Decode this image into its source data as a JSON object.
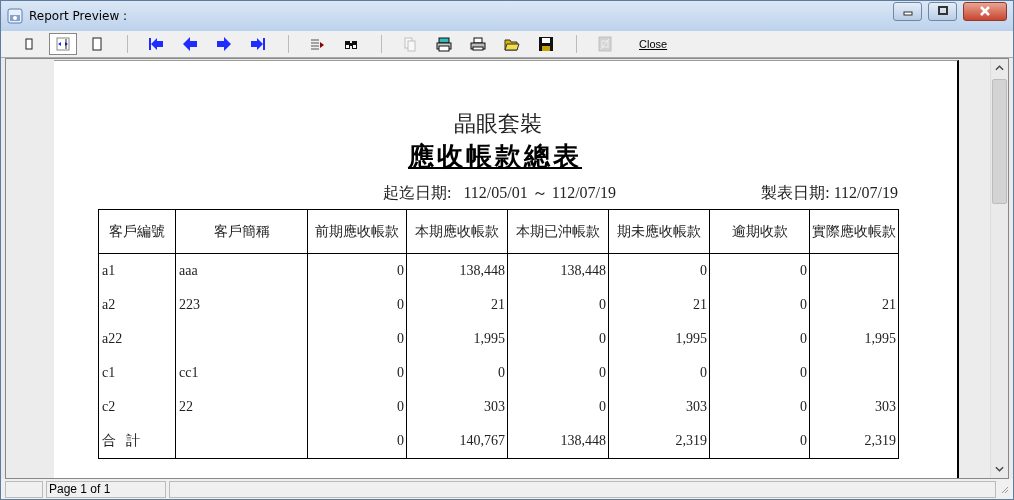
{
  "window": {
    "title": "Report Preview :"
  },
  "toolbar": [
    [
      {
        "kind": "page-small",
        "selected": false
      },
      {
        "kind": "page-width",
        "selected": true
      },
      {
        "kind": "page-full",
        "selected": false
      }
    ],
    [
      {
        "kind": "first"
      },
      {
        "kind": "prev"
      },
      {
        "kind": "next"
      },
      {
        "kind": "last"
      }
    ],
    [
      {
        "kind": "goto"
      },
      {
        "kind": "find"
      }
    ],
    [
      {
        "kind": "pages",
        "disabled": true
      },
      {
        "kind": "print-setup"
      },
      {
        "kind": "print"
      },
      {
        "kind": "open"
      },
      {
        "kind": "save"
      }
    ],
    [
      {
        "kind": "export",
        "disabled": true
      },
      {
        "kind": "text",
        "label": "Close"
      }
    ]
  ],
  "report": {
    "company": "晶眼套裝",
    "title": "應收帳款總表",
    "period_label": "起迄日期:",
    "period": "112/05/01 ～ 112/07/19",
    "print_date": "製表日期: 112/07/19",
    "table": {
      "columns": [
        "客戶編號",
        "客戶簡稱",
        "前期應收帳款",
        "本期應收帳款",
        "本期已沖帳款",
        "期未應收帳款",
        "逾期收款",
        "實際應收帳款"
      ],
      "rows": [
        {
          "column_1": "a1",
          "column_2": "aaa",
          "column_3": "0",
          "column_4": "138,448",
          "column_5": "138,448",
          "column_6": "0",
          "column_7": "0"
        },
        {
          "column_1": "a2",
          "column_2": "223",
          "column_3": "0",
          "column_4": "21",
          "column_5": "0",
          "column_6": "21",
          "column_7": "0",
          "column_8": "21"
        },
        {
          "column_1": "a22",
          "column_3": "0",
          "column_4": "1,995",
          "column_5": "0",
          "column_6": "1,995",
          "column_7": "0",
          "column_8": "1,995"
        },
        {
          "column_1": "c1",
          "column_2": "cc1",
          "column_3": "0",
          "column_4": "0",
          "column_5": "0",
          "column_6": "0",
          "column_7": "0"
        },
        {
          "column_1": "c2",
          "column_2": "22",
          "column_3": "0",
          "column_4": "303",
          "column_5": "0",
          "column_6": "303",
          "column_7": "0",
          "column_8": "303"
        }
      ],
      "total": {
        "column_1": "合 計",
        "column_3": "0",
        "column_4": "140,767",
        "column_5": "138,448",
        "column_6": "2,319",
        "column_7": "0",
        "column_8": "2,319"
      }
    }
  },
  "status_bar": {
    "page": "Page 1 of 1"
  }
}
